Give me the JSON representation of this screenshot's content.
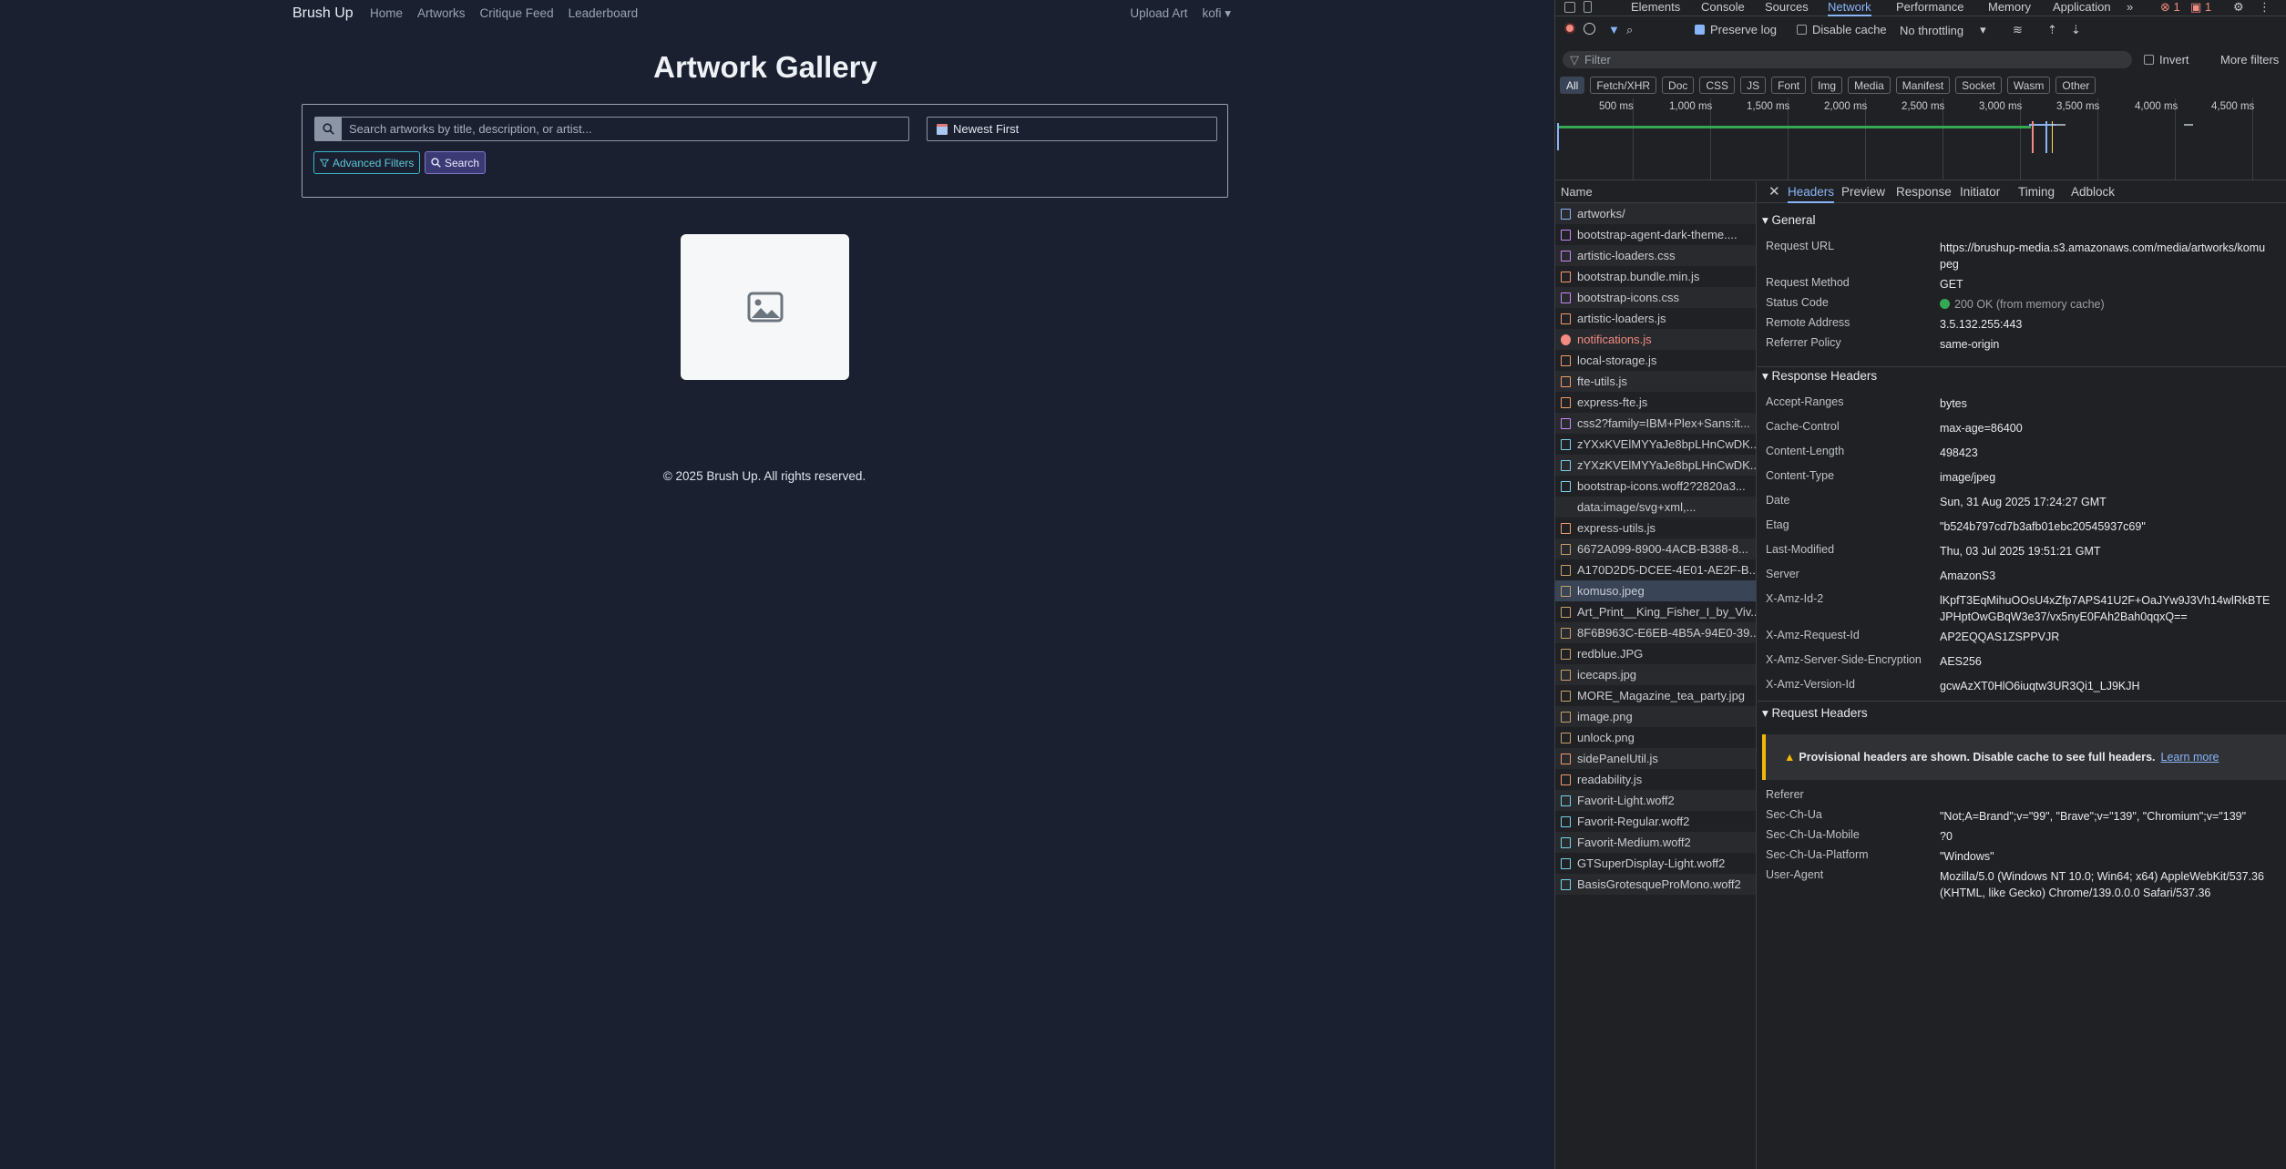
{
  "app": {
    "brand": "Brush Up",
    "nav": [
      "Home",
      "Artworks",
      "Critique Feed",
      "Leaderboard"
    ],
    "upload": "Upload Art",
    "user": "kofi ▾"
  },
  "gallery": {
    "title": "Artwork Gallery",
    "search_placeholder": "Search artworks by title, description, or artist...",
    "sort": "Newest First",
    "advanced": "Advanced Filters",
    "search": "Search",
    "footer": "© 2025 Brush Up. All rights reserved."
  },
  "devtools": {
    "tabs": [
      "Elements",
      "Console",
      "Sources",
      "Network",
      "Performance",
      "Memory",
      "Application"
    ],
    "errors": "1",
    "warnings": "1",
    "preserve": "Preserve log",
    "disable": "Disable cache",
    "throttle": "No throttling",
    "filter": "Filter",
    "invert": "Invert",
    "more": "More filters",
    "types": [
      "All",
      "Fetch/XHR",
      "Doc",
      "CSS",
      "JS",
      "Font",
      "Img",
      "Media",
      "Manifest",
      "Socket",
      "Wasm",
      "Other"
    ],
    "ticks": [
      "500 ms",
      "1,000 ms",
      "1,500 ms",
      "2,000 ms",
      "2,500 ms",
      "3,000 ms",
      "3,500 ms",
      "4,000 ms",
      "4,500 ms"
    ],
    "name_header": "Name",
    "requests": [
      {
        "n": "artworks/",
        "t": "doc"
      },
      {
        "n": "bootstrap-agent-dark-theme....",
        "t": "css"
      },
      {
        "n": "artistic-loaders.css",
        "t": "css"
      },
      {
        "n": "bootstrap.bundle.min.js",
        "t": "js"
      },
      {
        "n": "bootstrap-icons.css",
        "t": "css"
      },
      {
        "n": "artistic-loaders.js",
        "t": "js"
      },
      {
        "n": "notifications.js",
        "t": "err"
      },
      {
        "n": "local-storage.js",
        "t": "js"
      },
      {
        "n": "fte-utils.js",
        "t": "js"
      },
      {
        "n": "express-fte.js",
        "t": "js"
      },
      {
        "n": "css2?family=IBM+Plex+Sans:it...",
        "t": "css"
      },
      {
        "n": "zYXxKVElMYYaJe8bpLHnCwDK...",
        "t": "font"
      },
      {
        "n": "zYXzKVElMYYaJe8bpLHnCwDK...",
        "t": "font"
      },
      {
        "n": "bootstrap-icons.woff2?2820a3...",
        "t": "font"
      },
      {
        "n": "data:image/svg+xml,...",
        "t": "none"
      },
      {
        "n": "express-utils.js",
        "t": "js"
      },
      {
        "n": "6672A099-8900-4ACB-B388-8...",
        "t": "img"
      },
      {
        "n": "A170D2D5-DCEE-4E01-AE2F-B...",
        "t": "img"
      },
      {
        "n": "komuso.jpeg",
        "t": "img",
        "sel": true
      },
      {
        "n": "Art_Print__King_Fisher_I_by_Viv...",
        "t": "img"
      },
      {
        "n": "8F6B963C-E6EB-4B5A-94E0-39...",
        "t": "img"
      },
      {
        "n": "redblue.JPG",
        "t": "img"
      },
      {
        "n": "icecaps.jpg",
        "t": "img"
      },
      {
        "n": "MORE_Magazine_tea_party.jpg",
        "t": "img"
      },
      {
        "n": "image.png",
        "t": "img"
      },
      {
        "n": "unlock.png",
        "t": "img"
      },
      {
        "n": "sidePanelUtil.js",
        "t": "js"
      },
      {
        "n": "readability.js",
        "t": "js"
      },
      {
        "n": "Favorit-Light.woff2",
        "t": "font"
      },
      {
        "n": "Favorit-Regular.woff2",
        "t": "font"
      },
      {
        "n": "Favorit-Medium.woff2",
        "t": "font"
      },
      {
        "n": "GTSuperDisplay-Light.woff2",
        "t": "font"
      },
      {
        "n": "BasisGrotesqueProMono.woff2",
        "t": "font"
      }
    ],
    "detail_tabs": [
      "Headers",
      "Preview",
      "Response",
      "Initiator",
      "Timing",
      "Adblock"
    ],
    "general_title": "General",
    "general": [
      {
        "k": "Request URL",
        "v": "https://brushup-media.s3.amazonaws.com/media/artworks/komu\npeg"
      },
      {
        "k": "Request Method",
        "v": "GET"
      },
      {
        "k": "Status Code",
        "v": "200 OK (from memory cache)"
      },
      {
        "k": "Remote Address",
        "v": "3.5.132.255:443"
      },
      {
        "k": "Referrer Policy",
        "v": "same-origin"
      }
    ],
    "response_title": "Response Headers",
    "response": [
      {
        "k": "Accept-Ranges",
        "v": "bytes"
      },
      {
        "k": "Cache-Control",
        "v": "max-age=86400"
      },
      {
        "k": "Content-Length",
        "v": "498423"
      },
      {
        "k": "Content-Type",
        "v": "image/jpeg"
      },
      {
        "k": "Date",
        "v": "Sun, 31 Aug 2025 17:24:27 GMT"
      },
      {
        "k": "Etag",
        "v": "\"b524b797cd7b3afb01ebc20545937c69\""
      },
      {
        "k": "Last-Modified",
        "v": "Thu, 03 Jul 2025 19:51:21 GMT"
      },
      {
        "k": "Server",
        "v": "AmazonS3"
      },
      {
        "k": "X-Amz-Id-2",
        "v": "lKpfT3EqMihuOOsU4xZfp7APS41U2F+OaJYw9J3Vh14wlRkBTE\nJPHptOwGBqW3e37/vx5nyE0FAh2Bah0qqxQ=="
      },
      {
        "k": "X-Amz-Request-Id",
        "v": "AP2EQQAS1ZSPPVJR"
      },
      {
        "k": "X-Amz-Server-Side-Encryption",
        "v": "AES256"
      },
      {
        "k": "X-Amz-Version-Id",
        "v": "gcwAzXT0HlO6iuqtw3UR3Qi1_LJ9KJH"
      }
    ],
    "request_title": "Request Headers",
    "warn": "Provisional headers are shown. Disable cache to see full headers.",
    "learn": "Learn more",
    "request": [
      {
        "k": "Referer",
        "v": ""
      },
      {
        "k": "Sec-Ch-Ua",
        "v": "\"Not;A=Brand\";v=\"99\", \"Brave\";v=\"139\", \"Chromium\";v=\"139\""
      },
      {
        "k": "Sec-Ch-Ua-Mobile",
        "v": "?0"
      },
      {
        "k": "Sec-Ch-Ua-Platform",
        "v": "\"Windows\""
      },
      {
        "k": "User-Agent",
        "v": "Mozilla/5.0 (Windows NT 10.0; Win64; x64) AppleWebKit/537.36\n(KHTML, like Gecko) Chrome/139.0.0.0 Safari/537.36"
      }
    ]
  }
}
